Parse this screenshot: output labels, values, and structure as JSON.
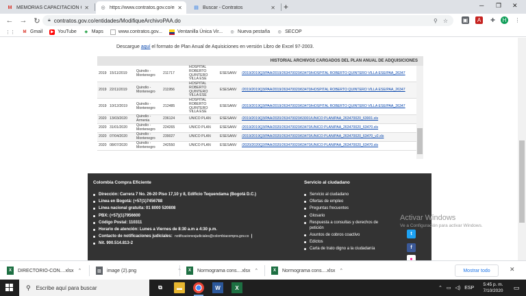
{
  "browser": {
    "tabs": [
      {
        "title": "MEMORIAS CAPACITACIÓN CON",
        "favicon": "gmail-icon",
        "active": false
      },
      {
        "title": "https://www.contratos.gov.co/en",
        "favicon": "globe-icon",
        "active": true
      },
      {
        "title": "Buscar - Contratos",
        "favicon": "contratos-icon",
        "active": false
      }
    ],
    "new_tab": "+",
    "url": "contratos.gov.co/entidades/ModifiqueArchivoPAA.do",
    "profile_initial": "H",
    "bookmarks": [
      {
        "label": "Gmail",
        "icon": "gmail-icon"
      },
      {
        "label": "YouTube",
        "icon": "youtube-icon"
      },
      {
        "label": "Maps",
        "icon": "maps-icon"
      },
      {
        "label": "www.contratos.gov...",
        "icon": "page-icon"
      },
      {
        "label": "Ventanilla Única Vir...",
        "icon": "flag-icon"
      },
      {
        "label": "Nueva pestaña",
        "icon": "globe-icon"
      },
      {
        "label": "SECOP",
        "icon": "globe-icon"
      }
    ]
  },
  "page": {
    "download_pre": "Descargue",
    "download_link": "aquí",
    "download_post": "el formato de Plan Anual de Aquisiciones en versión Libro de Excel 97-2003.",
    "history_title": "HISTORIAL ARCHIVOS CARGADOS DEL PLAN ANUAL DE ADQUISICIONES",
    "rows": [
      {
        "year": "2019",
        "date": "15/11/2019",
        "location": "Quindío - Montenegro",
        "code": "211717",
        "entity": "HOSPITAL ROBERTO QUINTERO VILLA ESE",
        "user": "ESESANV",
        "file": "/2019/2019Q3/PAA/2019/263470020/63470/HOSPITAL ROBERTO QUINTERO VILLA ESE/PAA_26347"
      },
      {
        "year": "2019",
        "date": "22/11/2019",
        "location": "Quindío - Montenegro",
        "code": "211956",
        "entity": "HOSPITAL ROBERTO QUINTERO VILLA ESE",
        "user": "ESESANV",
        "file": "/2019/2019Q3/PAA/2019/263470020/63470/HOSPITAL ROBERTO QUINTERO VILLA ESE/PAA_26347"
      },
      {
        "year": "2019",
        "date": "10/12/2019",
        "location": "Quindío - Montenegro",
        "code": "212485",
        "entity": "HOSPITAL ROBERTO QUINTERO VILLA ESE",
        "user": "ESESANV",
        "file": "/2019/2019Q3/PAA/2019/263470020/63470/HOSPITAL ROBERTO QUINTERO VILLA ESE/PAA_26347"
      },
      {
        "year": "2020",
        "date": "13/03/2020",
        "location": "Quindío - Armenia",
        "code": "236124",
        "entity": "UNICO PLAN",
        "user": "ESESANV",
        "file": "/2019/2019Q3/PAA/2020/263470020/63001/UNICO PLAN/PAA_263470020_63001.xls"
      },
      {
        "year": "2020",
        "date": "31/01/2020",
        "location": "Quindío - Montenegro",
        "code": "224265",
        "entity": "UNICO PLAN",
        "user": "ESESANV",
        "file": "/2019/2019Q3/PAA/2020/263470020/63470/UNICO PLAN/PAA_263470020_63470.xls"
      },
      {
        "year": "2020",
        "date": "07/04/2020",
        "location": "Quindío - Montenegro",
        "code": "239027",
        "entity": "UNICO PLAN",
        "user": "ESESANV",
        "file": "/2019/2019Q3/PAA/2020/263470020/63470/UNICO PLAN/PAA_263470020_63470_v2.xls"
      },
      {
        "year": "2020",
        "date": "08/07/2020",
        "location": "Quindío - Montenegro",
        "code": "242550",
        "entity": "UNICO PLAN",
        "user": "ESESANV",
        "file": "/2020/2020Q2/PAA/2020/263470020/63470/UNICO PLAN/PAA_263470020_63470.xls"
      }
    ]
  },
  "footer": {
    "org_title": "Colombia Compra Eficiente",
    "info": [
      "Dirección: Carrera 7 No. 26-20 Piso 17,10 y 8, Edificio Tequendama (Bogotá D.C.)",
      "Línea en Bogotá: (+57(1)7456788",
      "Línea nacional gratuita: 01 8000 520808",
      "PBX: (+57)(1)7956600",
      "Código Postal: 110311",
      "Horario de atención: Lunes a Viernes de 8:30 a.m a 4:30 p.m.",
      "Nit. 900.514.813-2"
    ],
    "notif_label": "Contacto de notificaciones judiciales:",
    "notif_email": "notificacionesjudiciales@colombiacompra.gov.co",
    "service_title": "Servicio al ciudadano",
    "services": [
      "Servicio al ciudadano",
      "Ofertas de empleo",
      "Preguntas frecuentes",
      "Glosario",
      "Respuesta a consultas y derechos de petición",
      "Asuntos de cobros coactivo",
      "Edictos",
      "Carta de trato digno a la ciudadanía"
    ],
    "social": [
      {
        "icon": "twitter-icon",
        "color": "#1da1f2",
        "glyph": "t"
      },
      {
        "icon": "facebook-icon",
        "color": "#3b5998",
        "glyph": "f"
      },
      {
        "icon": "youtube-icon",
        "color": "#cc181e",
        "glyph": "▶"
      },
      {
        "icon": "flickr-icon",
        "color": "#ffffff",
        "glyph": "●"
      },
      {
        "icon": "rss-icon",
        "color": "#f26522",
        "glyph": ")"
      }
    ]
  },
  "watermark": {
    "title": "Activar Windows",
    "subtitle": "Ve a Configuración para activar Windows."
  },
  "downloads": {
    "items": [
      {
        "name": "DIRECTORIO-CON....xlsx",
        "icon": "excel-file-icon",
        "color": "#1d6f42"
      },
      {
        "name": "image (2).png",
        "icon": "image-file-icon",
        "color": "#5f6368"
      },
      {
        "name": "Normograma cons....xlsx",
        "icon": "excel-file-icon",
        "color": "#1d6f42"
      },
      {
        "name": "Normograma cons....xlsx",
        "icon": "excel-file-icon",
        "color": "#1d6f42"
      }
    ],
    "show_all": "Mostrar todo"
  },
  "taskbar": {
    "search_placeholder": "Escribe aquí para buscar",
    "lang": "ESP",
    "time": "5:45 p. m.",
    "date": "7/10/2020"
  }
}
